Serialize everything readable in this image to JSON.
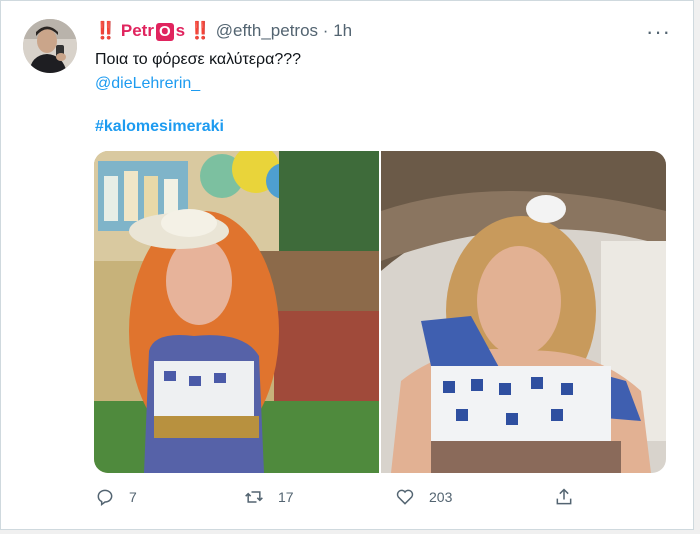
{
  "tweet": {
    "display_name_prefix": "‼️ Petr",
    "display_name_boxed": "O",
    "display_name_suffix": "s ‼️",
    "handle": "@efth_petros",
    "separator": "·",
    "time": "1h",
    "text": "Ποια το φόρεσε καλύτερα???",
    "mention": "@dieLehrerin_",
    "hashtag": "#kalomesimeraki",
    "more_icon": "···"
  },
  "actions": {
    "replies": "7",
    "retweets": "17",
    "likes": "203"
  },
  "colors": {
    "accent": "#1d9bf0",
    "text": "#0f1419",
    "muted": "#536471",
    "badge": "#e0245e"
  },
  "icons": [
    "reply-icon",
    "retweet-icon",
    "like-icon",
    "share-icon",
    "more-icon"
  ]
}
